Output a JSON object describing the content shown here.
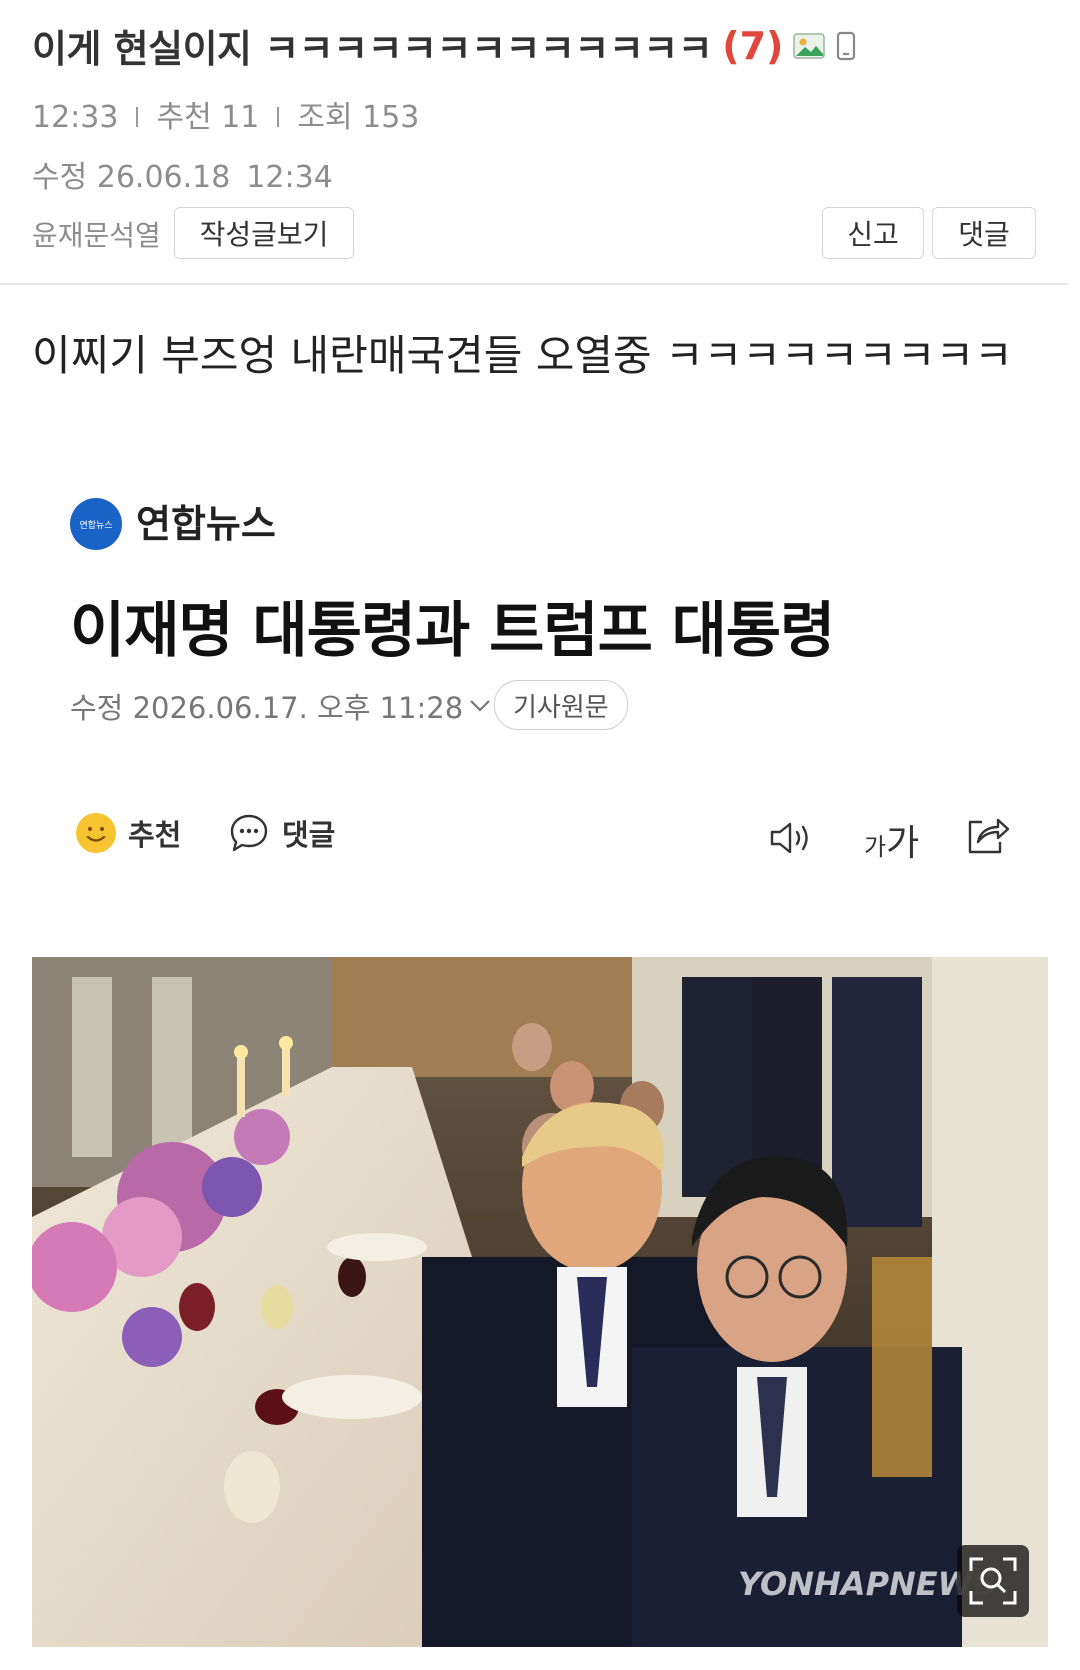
{
  "post": {
    "title": "이게 현실이지 ㅋㅋㅋㅋㅋㅋㅋㅋㅋㅋㅋㅋㅋ",
    "comment_count": "(7)",
    "time": "12:33",
    "recommend": "추천 11",
    "views": "조회 153",
    "edited_label": "수정 26.06.18",
    "edited_time": "12:34",
    "author": "윤재문석열",
    "view_posts_label": "작성글보기",
    "report_label": "신고",
    "comment_label": "댓글",
    "body": "이찌기 부즈엉 내란매국견들 오열중 ㅋㅋㅋㅋㅋㅋㅋㅋㅋ"
  },
  "article": {
    "source_logo_text": "연합뉴스",
    "source": "연합뉴스",
    "headline": "이재명 대통령과 트럼프 대통령",
    "date": "수정 2026.06.17. 오후 11:28",
    "original_label": "기사원문",
    "like_label": "추천",
    "comment_label": "댓글",
    "font_label_small": "가",
    "font_label_large": "가",
    "watermark": "YONHAPNEWS"
  },
  "colors": {
    "accent_red": "#e0463a",
    "yonhap_blue": "#1a63c6",
    "smile_yellow": "#f6c430"
  },
  "icons": [
    "image-icon",
    "mobile-icon",
    "chevron-down-icon",
    "smile-icon",
    "speech-bubble-icon",
    "speaker-icon",
    "font-size-icon",
    "share-icon",
    "zoom-icon"
  ]
}
